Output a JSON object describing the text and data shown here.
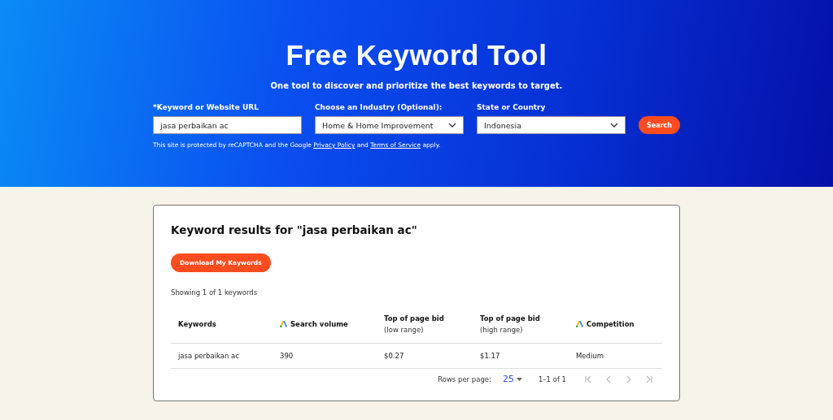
{
  "hero": {
    "title": "Free Keyword Tool",
    "subtitle": "One tool to discover and prioritize the best keywords to target.",
    "fields": [
      {
        "kind": "text",
        "label": "*Keyword or Website URL",
        "value": "jasa perbaikan ac"
      },
      {
        "kind": "select",
        "label": "Choose an Industry (Optional):",
        "value": "Home & Home Improvement"
      },
      {
        "kind": "select",
        "label": "State or Country",
        "value": "Indonesia"
      }
    ],
    "search_button": "Search",
    "notice": [
      {
        "kind": "text",
        "text": "This site is protected by reCAPTCHA and the Google "
      },
      {
        "kind": "link",
        "text": "Privacy Policy"
      },
      {
        "kind": "text",
        "text": " and "
      },
      {
        "kind": "link",
        "text": "Terms of Service"
      },
      {
        "kind": "text",
        "text": " apply."
      }
    ]
  },
  "results": {
    "title": "Keyword results for \"jasa perbaikan ac\"",
    "download_button": "Download My Keywords",
    "showing": "Showing 1 of 1 keywords",
    "columns": [
      {
        "title": "Keywords",
        "ads_icon": false
      },
      {
        "title": "Search volume",
        "ads_icon": true
      },
      {
        "title": "Top of page bid",
        "subtitle": "(low range)",
        "ads_icon": false
      },
      {
        "title": "Top of page bid",
        "subtitle": "(high range)",
        "ads_icon": false
      },
      {
        "title": "Competition",
        "ads_icon": true
      }
    ],
    "rows": [
      [
        "jasa perbaikan ac",
        "390",
        "$0.27",
        "$1.17",
        "Medium"
      ]
    ],
    "pagination": {
      "rows_label": "Rows per page:",
      "rows_value": "25",
      "range": "1–1 of 1",
      "buttons": [
        {
          "kind": "first",
          "disabled": true
        },
        {
          "kind": "prev",
          "disabled": true
        },
        {
          "kind": "next",
          "disabled": true
        },
        {
          "kind": "last",
          "disabled": true
        }
      ]
    }
  }
}
